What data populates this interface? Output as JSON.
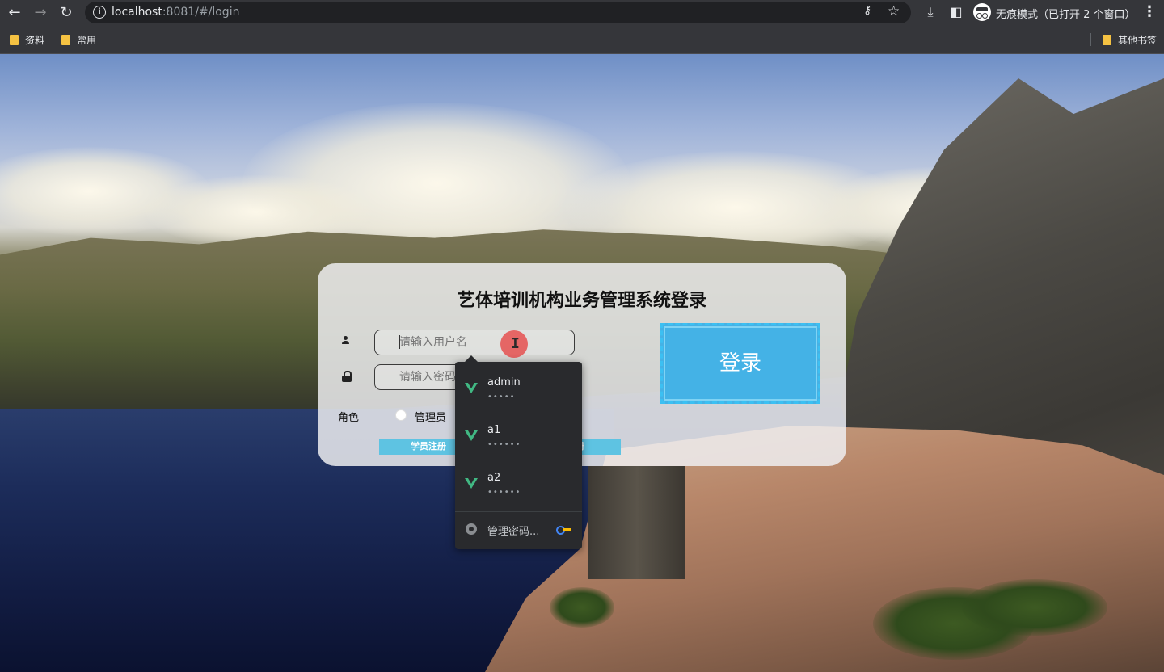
{
  "browser": {
    "url_host": "localhost",
    "url_rest": ":8081/#/login",
    "incognito_label": "无痕模式（已打开 2 个窗口）",
    "nav_icons": [
      "back-icon",
      "forward-icon",
      "reload-icon"
    ],
    "toolbar_icons": [
      "info-icon",
      "key-icon",
      "star-icon",
      "download-icon",
      "sidepanel-icon",
      "incognito-icon",
      "menu-icon"
    ]
  },
  "bookmarks": {
    "items": [
      {
        "label": "资料",
        "icon": "folder-icon"
      },
      {
        "label": "常用",
        "icon": "folder-icon"
      }
    ],
    "other": {
      "label": "其他书签",
      "icon": "folder-icon"
    }
  },
  "login": {
    "title": "艺体培训机构业务管理系统登录",
    "username_placeholder": "请输入用户名",
    "password_placeholder": "请输入密码",
    "role_label": "角色",
    "role_option": "管理员",
    "student_register": "学员注册",
    "other_register_partial": "册",
    "login_button": "登录"
  },
  "autofill": {
    "items": [
      {
        "username": "admin",
        "password_mask": "•••••"
      },
      {
        "username": "a1",
        "password_mask": "••••••"
      },
      {
        "username": "a2",
        "password_mask": "••••••"
      }
    ],
    "manage_label": "管理密码..."
  },
  "colors": {
    "login_button": "#44b2e6",
    "register_button": "#5ec3e2",
    "cursor_highlight": "#e55050",
    "vue_green": "#41b883"
  }
}
